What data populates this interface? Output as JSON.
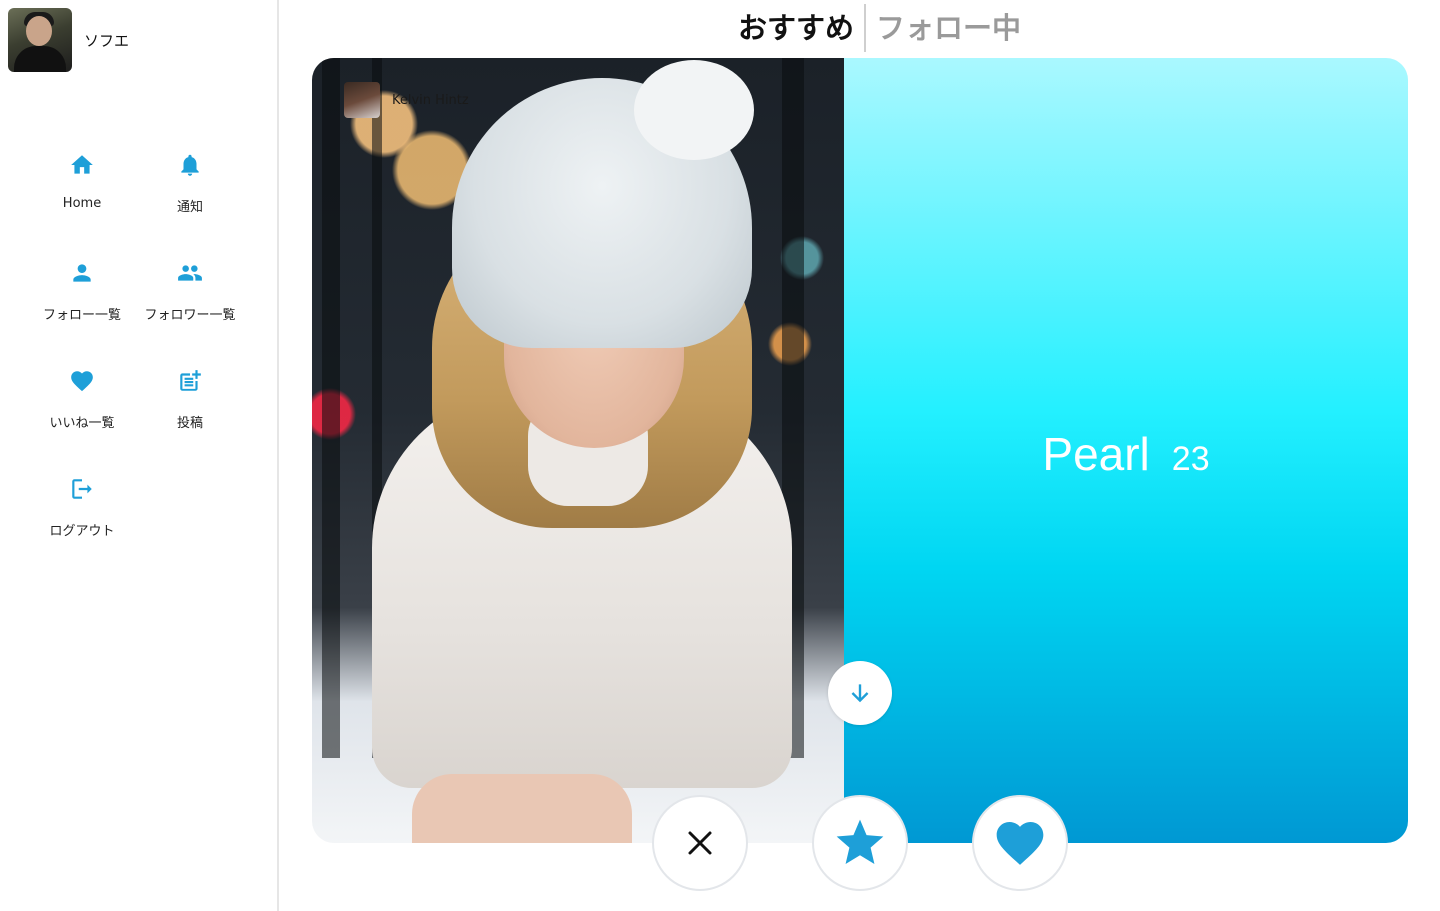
{
  "user": {
    "name": "ソフエ"
  },
  "sidebar": {
    "items": [
      {
        "label": "Home",
        "icon": "home-icon"
      },
      {
        "label": "通知",
        "icon": "bell-icon"
      },
      {
        "label": "フォロー一覧",
        "icon": "person-icon"
      },
      {
        "label": "フォロワー一覧",
        "icon": "people-icon"
      },
      {
        "label": "いいね一覧",
        "icon": "heart-icon"
      },
      {
        "label": "投稿",
        "icon": "post-add-icon"
      },
      {
        "label": "ログアウト",
        "icon": "logout-icon"
      }
    ]
  },
  "tabs": [
    {
      "label": "おすすめ",
      "active": true
    },
    {
      "label": "フォロー中",
      "active": false
    }
  ],
  "card": {
    "author": "Kelvin Hintz",
    "name": "Pearl",
    "age": "23"
  },
  "colors": {
    "accent": "#1e9fd8",
    "gradient_top": "#aaf8ff",
    "gradient_bottom": "#0098d3"
  }
}
